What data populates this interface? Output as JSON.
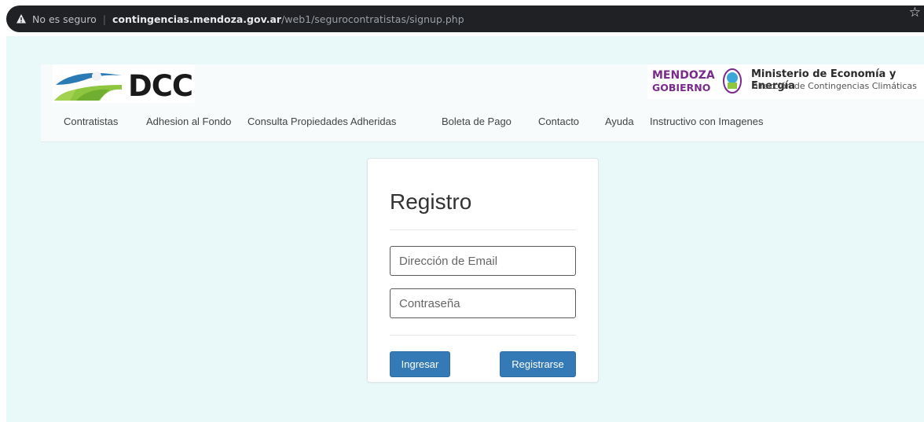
{
  "browser": {
    "security_label": "No es seguro",
    "url_domain": "contingencias.mendoza.gov.ar",
    "url_path": "/web1/segurocontratistas/signup.php"
  },
  "header": {
    "logo_text": "DCC",
    "gov_logo": {
      "line1": "MENDOZA",
      "line2": "GOBIERNO",
      "ministry": "Ministerio de Economía y Energía",
      "direction": "Dirección de Contingencias Climáticas"
    }
  },
  "nav": {
    "items": [
      {
        "label": "Contratistas"
      },
      {
        "label": "Adhesion al Fondo"
      },
      {
        "label": "Consulta Propiedades Adheridas"
      },
      {
        "label": "Boleta de Pago"
      },
      {
        "label": "Contacto"
      },
      {
        "label": "Ayuda"
      },
      {
        "label": "Instructivo con Imagenes"
      }
    ]
  },
  "form": {
    "title": "Registro",
    "email_placeholder": "Dirección de Email",
    "password_placeholder": "Contraseña",
    "login_label": "Ingresar",
    "register_label": "Registrarse"
  },
  "colors": {
    "primary_button": "#337ab7",
    "page_background": "#e9f8f9",
    "brand_purple": "#7a2a8a"
  },
  "icons": [
    "warning-icon",
    "star-icon",
    "dcc-logo-icon",
    "mendoza-shield-icon"
  ]
}
